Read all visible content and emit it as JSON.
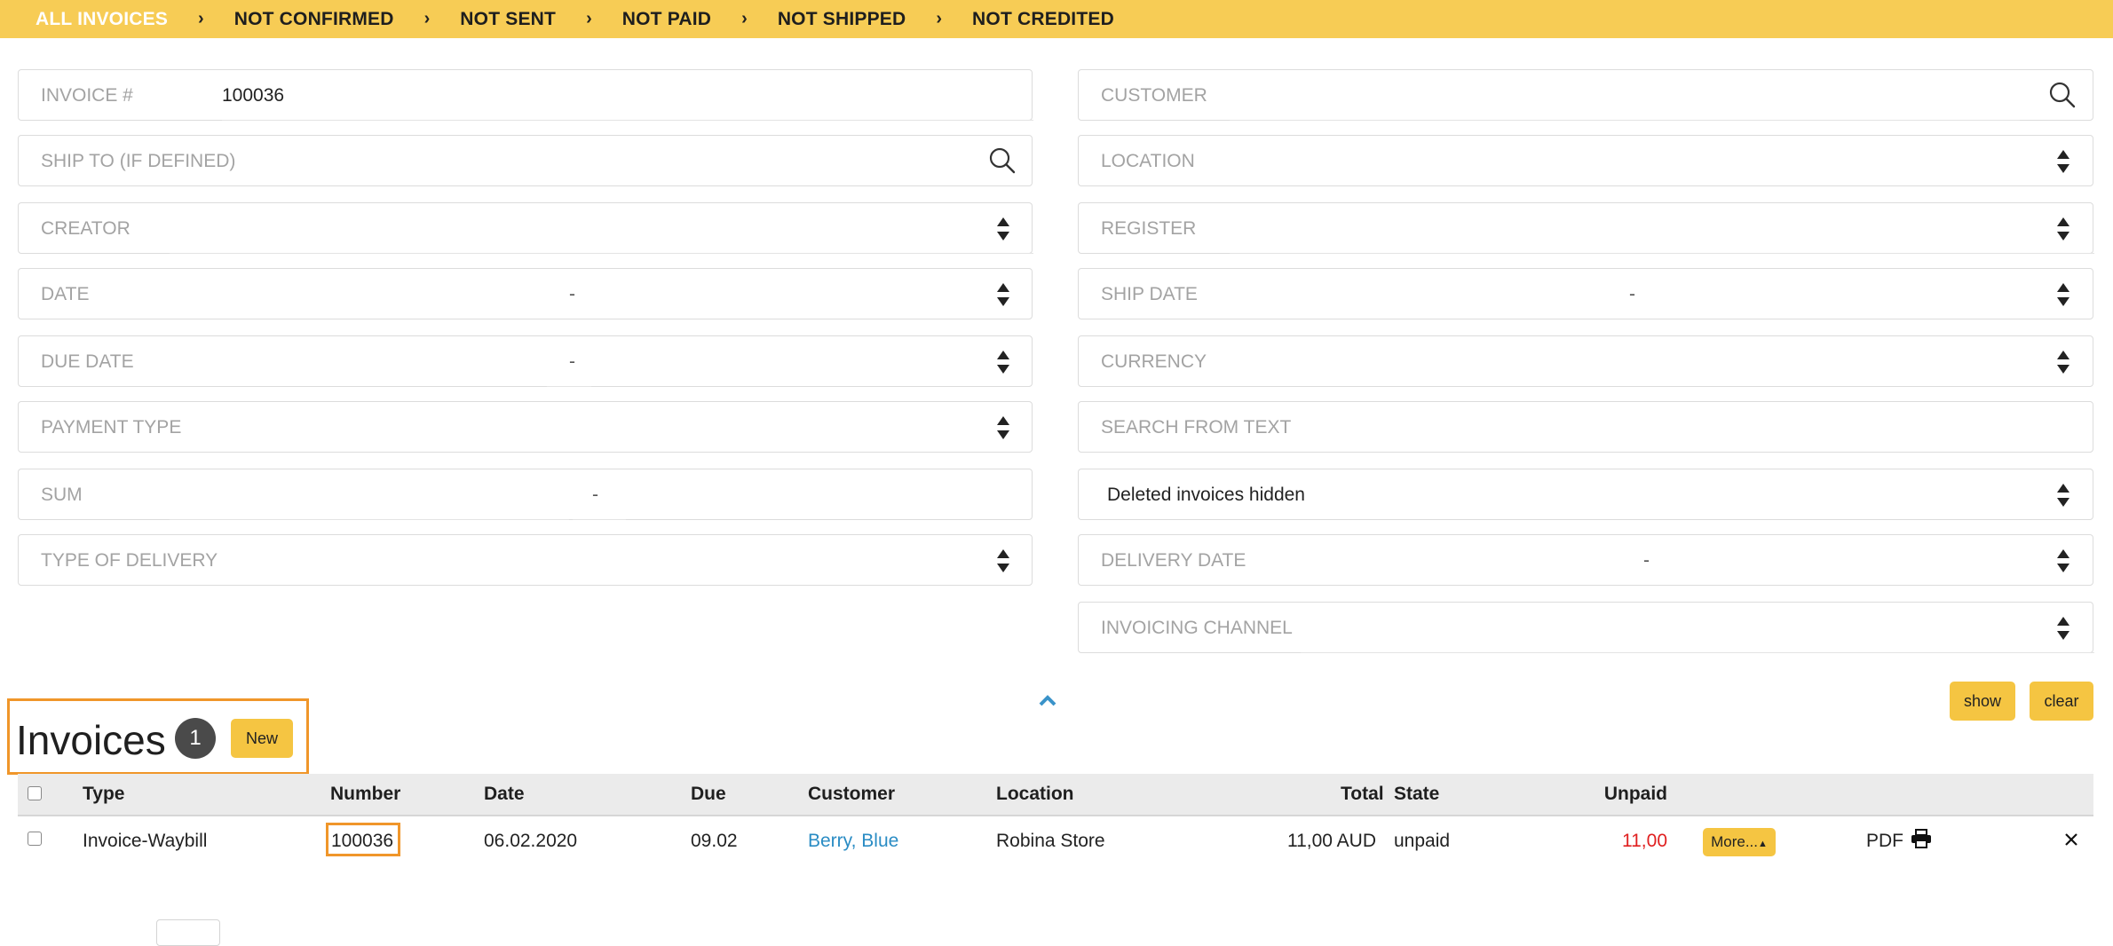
{
  "tabs": [
    {
      "label": "ALL INVOICES",
      "active": true
    },
    {
      "label": "NOT CONFIRMED"
    },
    {
      "label": "NOT SENT"
    },
    {
      "label": "NOT PAID"
    },
    {
      "label": "NOT SHIPPED"
    },
    {
      "label": "NOT CREDITED"
    }
  ],
  "tab_separator": "›",
  "filters": {
    "invoice_no": {
      "label": "INVOICE #",
      "value": "100036"
    },
    "ship_to": {
      "label": "SHIP TO (IF DEFINED)"
    },
    "creator": {
      "label": "CREATOR"
    },
    "date": {
      "label": "DATE",
      "dash": "-"
    },
    "due_date": {
      "label": "DUE DATE",
      "dash": "-"
    },
    "payment_type": {
      "label": "PAYMENT TYPE"
    },
    "sum": {
      "label": "SUM",
      "dash": "-"
    },
    "type_of_delivery": {
      "label": "TYPE OF DELIVERY"
    },
    "customer": {
      "label": "CUSTOMER"
    },
    "location": {
      "label": "LOCATION"
    },
    "register": {
      "label": "REGISTER"
    },
    "ship_date": {
      "label": "SHIP DATE",
      "dash": "-"
    },
    "currency": {
      "label": "CURRENCY"
    },
    "search_from_text": {
      "label": "SEARCH FROM TEXT"
    },
    "deleted_invoices": {
      "value": "Deleted invoices hidden"
    },
    "delivery_date": {
      "label": "DELIVERY DATE",
      "dash": "-"
    },
    "invoicing_channel": {
      "label": "INVOICING CHANNEL"
    }
  },
  "actions": {
    "show": "show",
    "clear": "clear"
  },
  "section": {
    "title": "Invoices",
    "count": "1",
    "new_label": "New"
  },
  "table": {
    "columns": [
      "Type",
      "Number",
      "Date",
      "Due",
      "Customer",
      "Location",
      "Total",
      "State",
      "Unpaid"
    ],
    "rows": [
      {
        "type": "Invoice-Waybill",
        "number": "100036",
        "date": "06.02.2020",
        "due": "09.02",
        "customer": "Berry, Blue",
        "location": "Robina Store",
        "total": "11,00 AUD",
        "state": "unpaid",
        "unpaid": "11,00",
        "more_label": "More...",
        "pdf_label": "PDF"
      }
    ]
  },
  "colors": {
    "accent": "#f7cc55",
    "button": "#f5c542",
    "highlight_box": "#f0962a",
    "link": "#2a8cc4",
    "unpaid": "#e02020"
  },
  "icons": [
    "search-icon",
    "sort-icon",
    "collapse-chevron-icon",
    "printer-icon",
    "delete-icon"
  ]
}
